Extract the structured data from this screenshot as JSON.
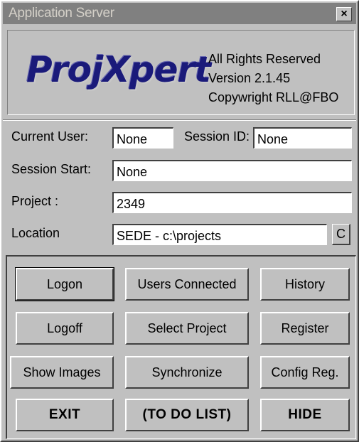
{
  "window": {
    "title": "Application Server",
    "close_glyph": "×"
  },
  "header": {
    "logo_text": "ProjXpert",
    "rights": "All Rights Reserved",
    "version": "Version 2.1.45",
    "copyright": "Copywright RLL@FBO"
  },
  "session": {
    "current_user_label": "Current User:",
    "current_user_value": "None",
    "session_id_label": "Session ID:",
    "session_id_value": "None",
    "session_start_label": "Session Start:",
    "session_start_value": "None",
    "project_label": "Project :",
    "project_value": "2349",
    "location_label": "Location",
    "location_value": "SEDE - c:\\projects",
    "location_button": "C"
  },
  "buttons": {
    "logon": "Logon",
    "users_connected": "Users Connected",
    "history": "History",
    "logoff": "Logoff",
    "select_project": "Select Project",
    "register": "Register",
    "show_images": "Show Images",
    "synchronize": "Synchronize",
    "config_reg": "Config Reg.",
    "exit": "EXIT",
    "todo_list": "(TO DO LIST)",
    "hide": "HIDE"
  },
  "colors": {
    "titlebar": "#808080",
    "face": "#c0c0c0",
    "logo": "#1a1a7a"
  }
}
